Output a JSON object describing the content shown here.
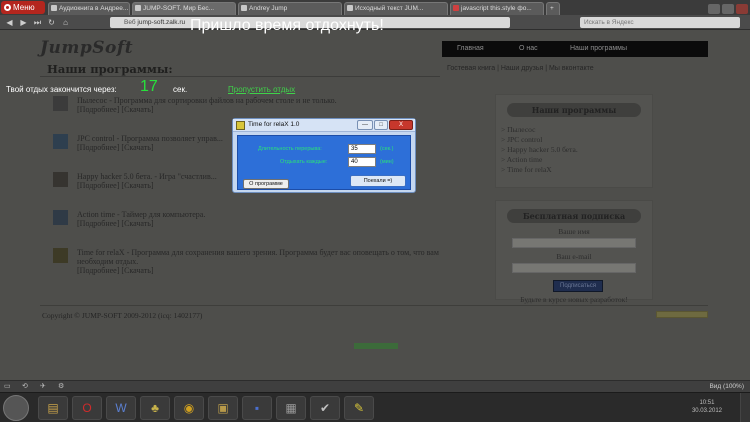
{
  "browser": {
    "menu_label": "Меню",
    "tabs": [
      {
        "label": "Аудиокнига в Андрее..."
      },
      {
        "label": "JUMP-SOFT. Мир Бес..."
      },
      {
        "label": "Andrey Jump"
      },
      {
        "label": "Исходный текст JUM..."
      },
      {
        "label": "javascript this.style фо..."
      }
    ],
    "address": {
      "badge": "Веб",
      "url": "jump-soft.zalk.ru"
    },
    "search_placeholder": "Искать в Яндекс"
  },
  "site": {
    "logo": "JumpSoft",
    "nav": [
      "Главная",
      "О нас",
      "Наши программы"
    ],
    "subnav": "Гостевая книга | Наши друзья | Мы вконтакте",
    "section_title": "Наши программы:",
    "programs": [
      {
        "name": "Пылесос",
        "desc": " - Программа для сортировки файлов на рабочем столе и не только.",
        "links": "[Подробнее] [Скачать]"
      },
      {
        "name": "JPC control",
        "desc": " - Программа позволяет управ...",
        "links": "[Подробнее] [Скачать]"
      },
      {
        "name": "Happy hacker 5.0 бета.",
        "desc": " - Игра \"счастлив...",
        "links": "[Подробнее] [Скачать]"
      },
      {
        "name": "Action time",
        "desc": " - Таймер для компьютера.",
        "links": "[Подробнее] [Скачать]"
      },
      {
        "name": "Time for relaX",
        "desc": " - Программа для сохранения вашего зрения. Программа будет вас оповещать о том, что вам необходим отдых.",
        "links": "[Подробнее] [Скачать]"
      }
    ],
    "sidebar_programs": {
      "title": "Наши программы",
      "items": [
        "> Пылесос",
        "> JPC control",
        "> Happy hacker 5.0 бета.",
        "> Action time",
        "> Time for relaX"
      ]
    },
    "subscribe": {
      "title": "Бесплатная подписка",
      "name_label": "Ваше имя",
      "email_label": "Ваш e-mail",
      "button": "Подписаться",
      "note": "Будьте в курсе новых разработок!"
    },
    "copyright": "Copyright © JUMP-SOFT 2009-2012 (icq: 1402177)"
  },
  "overlay": {
    "title": "Пришло время отдохнуть!",
    "countdown_label": "Твой отдых закончится через:",
    "countdown_value": "17",
    "countdown_unit": "сек.",
    "skip_link": "Пропустить отдых"
  },
  "dialog": {
    "title": "Time for relaX 1.0",
    "controls": [
      "—",
      "□",
      "X"
    ],
    "duration_label": "Длительность перерыва:",
    "duration_value": "35",
    "duration_unit": "(сек.)",
    "interval_label": "Отдыхать каждые:",
    "interval_value": "40",
    "interval_unit": "(мин)",
    "about_button": "О программе",
    "ok_button": "Поехали =)"
  },
  "statusbar": {
    "zoom": "Вид (100%)"
  },
  "taskbar": {
    "clock_time": "10:51",
    "clock_date": "30.03.2012"
  }
}
